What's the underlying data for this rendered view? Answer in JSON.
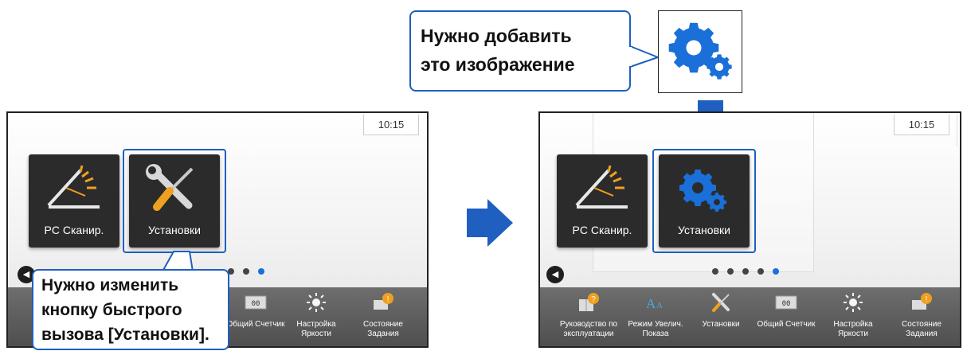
{
  "callouts": {
    "add_image_line1": "Нужно добавить",
    "add_image_line2": "это изображение",
    "change_button_line1": "Нужно изменить",
    "change_button_line2": "кнопку быстрого",
    "change_button_line3": "вызова [Установки]."
  },
  "before_screen": {
    "time": "10:15",
    "tiles": [
      {
        "label": "PC Сканир.",
        "icon": "scanner-icon"
      },
      {
        "label": "Установки",
        "icon": "wrench-screwdriver-icon"
      }
    ],
    "page_dots": {
      "count": 3,
      "active_index": 2
    },
    "taskbar": [
      {
        "label": "Общий Счетчик",
        "icon": "counter-icon"
      },
      {
        "label": "Настройка Яркости",
        "icon": "brightness-icon"
      },
      {
        "label": "Состояние Задания",
        "icon": "job-status-icon"
      }
    ]
  },
  "after_screen": {
    "time": "10:15",
    "tiles": [
      {
        "label": "PC Сканир.",
        "icon": "scanner-icon"
      },
      {
        "label": "Установки",
        "icon": "gears-icon"
      }
    ],
    "page_dots": {
      "count": 5,
      "active_index": 4
    },
    "taskbar": [
      {
        "label": "Руководство по эксплуатации",
        "icon": "manual-icon"
      },
      {
        "label": "Режим Увелич. Показа",
        "icon": "zoom-text-icon"
      },
      {
        "label": "Установки",
        "icon": "wrench-screwdriver-icon"
      },
      {
        "label": "Общий Счетчик",
        "icon": "counter-icon"
      },
      {
        "label": "Настройка Яркости",
        "icon": "brightness-icon"
      },
      {
        "label": "Состояние Задания",
        "icon": "job-status-icon"
      }
    ]
  },
  "colors": {
    "accent_blue": "#1f5fbf",
    "tile_dark": "#2b2b2b",
    "taskbar_gray": "#5a5a5a",
    "badge_orange": "#f0a020"
  }
}
